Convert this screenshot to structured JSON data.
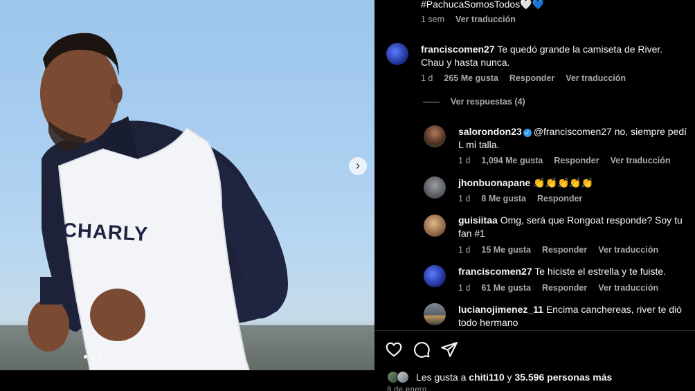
{
  "caption_tail": {
    "hashtag": "#PachucaSomosTodos",
    "emoji": "🤍💙",
    "time": "1 sem",
    "translate": "Ver traducción"
  },
  "photo": {
    "jersey_text": "CHARLY",
    "next_arrow": "›",
    "dots_count": 4,
    "active_dot": 1
  },
  "comments": [
    {
      "user": "franciscomen27",
      "text": "Te quedó grande la camiseta de River. Chau y hasta nunca.",
      "time": "1 d",
      "likes": "265 Me gusta",
      "reply": "Responder",
      "translate": "Ver traducción",
      "avatar_color": "#2a3fb0"
    }
  ],
  "view_replies": "Ver respuestas (4)",
  "replies": [
    {
      "user": "salorondon23",
      "verified": true,
      "mention": "@franciscomen27",
      "text": " no, siempre pedí L mi talla.",
      "time": "1 d",
      "likes": "1,094 Me gusta",
      "reply": "Responder",
      "translate": "Ver traducción",
      "avatar_color": "#6b4a3a"
    },
    {
      "user": "jhonbuonapane",
      "text": "👏👏👏👏👏",
      "time": "1 d",
      "likes": "8 Me gusta",
      "reply": "Responder",
      "avatar_color": "#8a8d90"
    },
    {
      "user": "guisiitaa",
      "text": "Omg, será que Rongoat responde? Soy tu fan #1",
      "time": "1 d",
      "likes": "15 Me gusta",
      "reply": "Responder",
      "translate": "Ver traducción",
      "avatar_color": "#c79b6a"
    },
    {
      "user": "franciscomen27",
      "text": "Te hiciste el estrella y te fuiste.",
      "time": "1 d",
      "likes": "61 Me gusta",
      "reply": "Responder",
      "translate": "Ver traducción",
      "avatar_color": "#2a3fb0"
    },
    {
      "user": "lucianojimenez_11",
      "text": "Encima canchereas, river te dió todo hermano",
      "avatar_color": "#5a5f66"
    }
  ],
  "likes_line": {
    "prefix": "Les gusta a ",
    "user": "chiti110",
    "middle": " y ",
    "count": "35.596 personas más"
  },
  "date_cut": "9 de enero"
}
